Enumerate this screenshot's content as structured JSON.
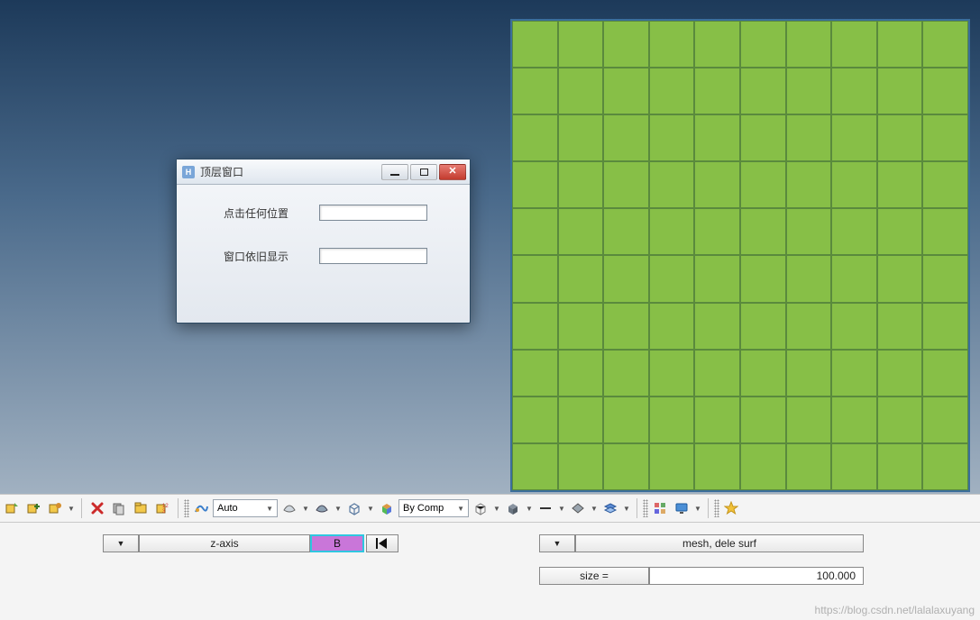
{
  "dialog": {
    "title": "顶层窗口",
    "row1_label": "点击任何位置",
    "row1_value": "",
    "row2_label": "窗口依旧显示",
    "row2_value": ""
  },
  "toolbar": {
    "auto_label": "Auto",
    "bycomp_label": "By Comp"
  },
  "panel": {
    "axis_label": "z-axis",
    "tag": "B",
    "command": "mesh, dele surf",
    "size_label": "size =",
    "size_value": "100.000"
  },
  "mesh": {
    "rows": 10,
    "cols": 10
  },
  "watermark": "https://blog.csdn.net/lalalaxuyang"
}
